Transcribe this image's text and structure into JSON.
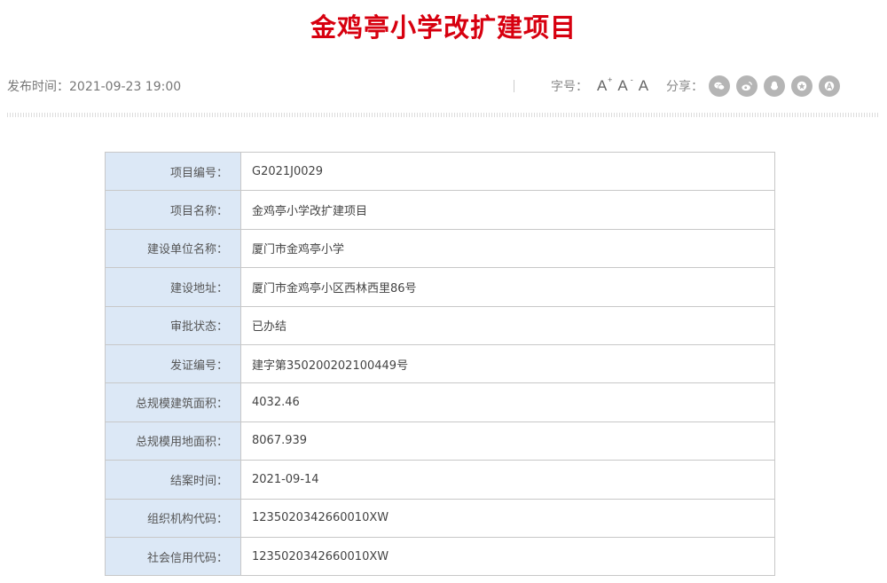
{
  "page": {
    "title": "金鸡亭小学改扩建项目",
    "publish_time": "发布时间：2021-09-23 19:00"
  },
  "toolbar": {
    "font_size_label": "字号：",
    "font_increase": "A",
    "font_decrease": "A",
    "font_reset": "A",
    "increase_mark": "+",
    "decrease_mark": "-",
    "share_label": "分享：",
    "share_icons": [
      "wechat-icon",
      "weibo-icon",
      "qq-icon",
      "qzone-icon",
      "douban-icon"
    ]
  },
  "colors": {
    "title": "#d7000f",
    "label_bg": "#dce8f6",
    "share_icon_bg": "#b5b5b5"
  },
  "table": {
    "rows": [
      {
        "label": "项目编号：",
        "value": "G2021J0029"
      },
      {
        "label": "项目名称：",
        "value": "金鸡亭小学改扩建项目"
      },
      {
        "label": "建设单位名称：",
        "value": "厦门市金鸡亭小学"
      },
      {
        "label": "建设地址：",
        "value": "厦门市金鸡亭小区西林西里86号"
      },
      {
        "label": "审批状态：",
        "value": "已办结"
      },
      {
        "label": "发证编号：",
        "value": "建字第350200202100449号"
      },
      {
        "label": "总规模建筑面积：",
        "value": "4032.46"
      },
      {
        "label": "总规模用地面积：",
        "value": "8067.939"
      },
      {
        "label": "结案时间：",
        "value": "2021-09-14"
      },
      {
        "label": "组织机构代码：",
        "value": "1235020342660010XW"
      },
      {
        "label": "社会信用代码：",
        "value": "1235020342660010XW"
      }
    ]
  }
}
